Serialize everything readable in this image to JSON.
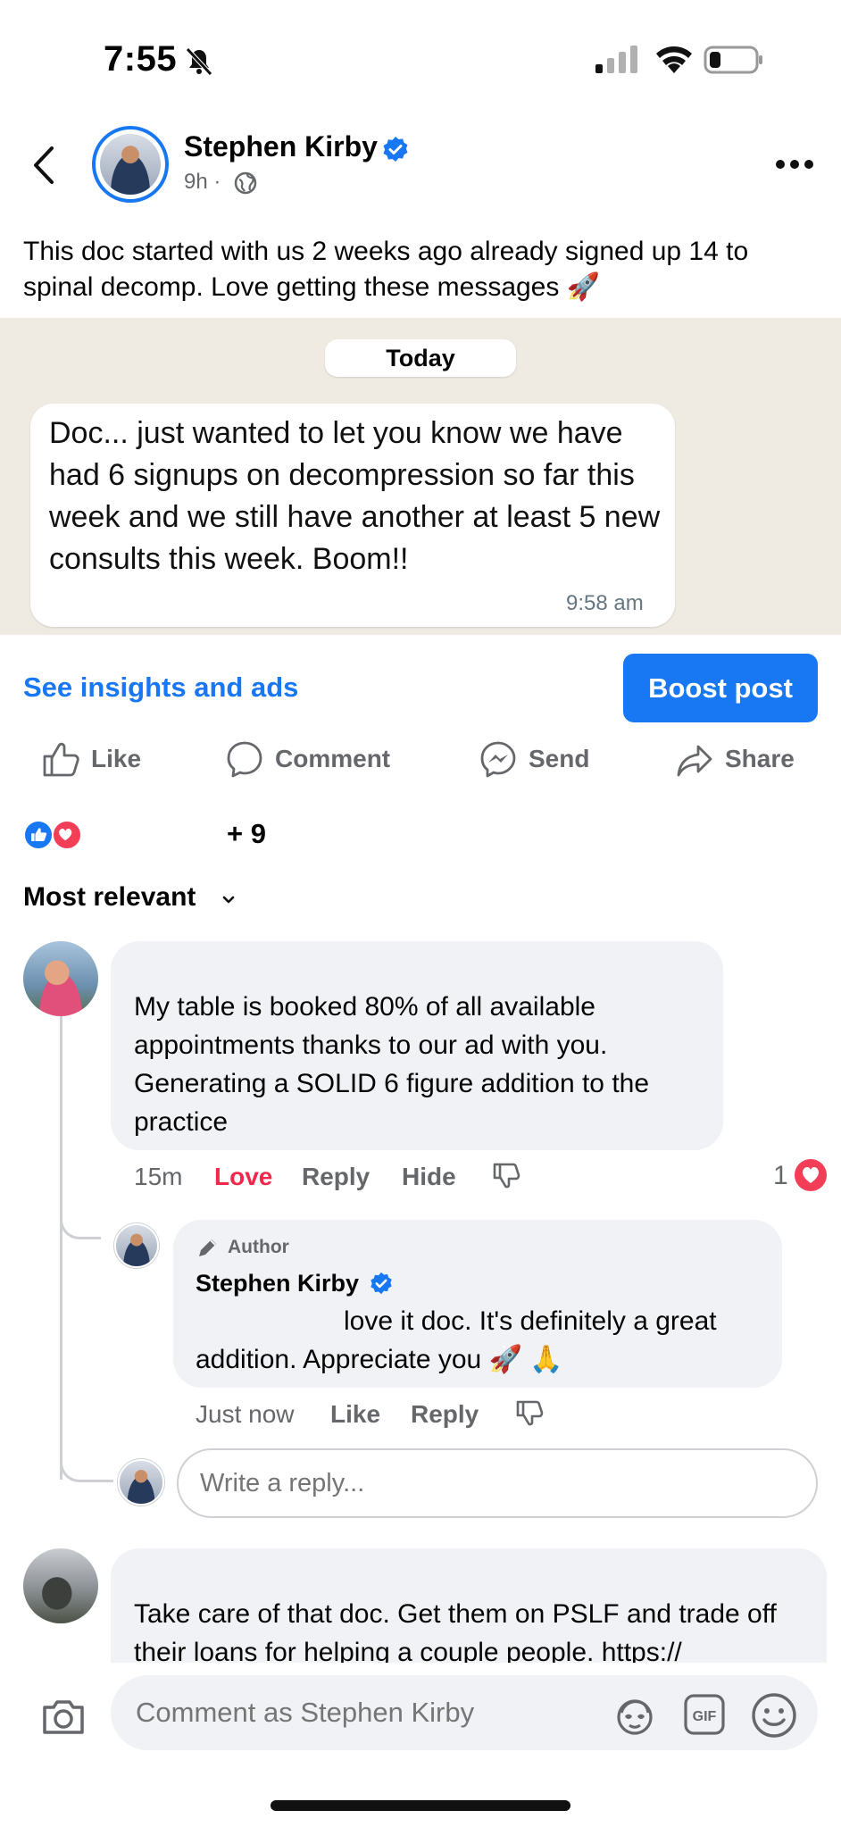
{
  "status_bar": {
    "time": "7:55"
  },
  "post": {
    "author": "Stephen Kirby",
    "meta": "9h ·",
    "caption": "This doc started with us 2 weeks ago already signed up 14 to spinal decomp. Love getting these messages 🚀"
  },
  "embedded_chat": {
    "date_pill": "Today",
    "message": "Doc... just wanted to let you know we have had 6 signups on decompression so far this week and we still have another at least 5 new consults this week. Boom!!",
    "time": "9:58 am"
  },
  "insights_link": "See insights and ads",
  "boost_button": "Boost post",
  "actions": {
    "like": "Like",
    "comment": "Comment",
    "send": "Send",
    "share": "Share"
  },
  "reactions": {
    "count": "+ 9"
  },
  "sort": {
    "label": "Most relevant"
  },
  "comments": [
    {
      "text": "My table is booked 80% of all available appointments thanks to our ad with you. Generating a SOLID 6 figure addition to the practice",
      "time": "15m",
      "reaction": "Love",
      "reply": "Reply",
      "hide": "Hide",
      "reaction_count": "1"
    },
    {
      "author_badge": "Author",
      "author": "Stephen Kirby",
      "text": "love it doc. It's definitely a great addition. Appreciate you 🚀 🙏",
      "time": "Just now",
      "like": "Like",
      "reply": "Reply"
    },
    {
      "text": "Take care of that doc. Get them on PSLF and trade off their loans for helping a couple people. https://"
    }
  ],
  "reply_input": {
    "placeholder": "Write a reply..."
  },
  "composer": {
    "placeholder": "Comment as Stephen Kirby",
    "gif_label": "GIF"
  }
}
